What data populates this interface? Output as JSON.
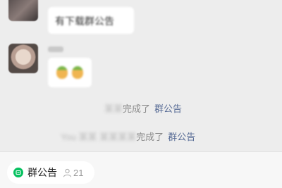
{
  "chat": {
    "messages": [
      {
        "text": "有下载群公告"
      },
      {
        "emoji": "sticker"
      }
    ],
    "system": [
      {
        "actor": "某某",
        "verb": "完成了",
        "link": "群公告"
      },
      {
        "actor": "You 某某 某某某某",
        "verb": "完成了",
        "link": "群公告"
      }
    ]
  },
  "bottom_bar": {
    "pill": {
      "icon": "group-notice-icon",
      "label": "群公告",
      "member_icon": "person-icon",
      "member_count": "21"
    }
  },
  "colors": {
    "link": "#576b95",
    "accent": "#07c160",
    "background": "#ededed"
  }
}
